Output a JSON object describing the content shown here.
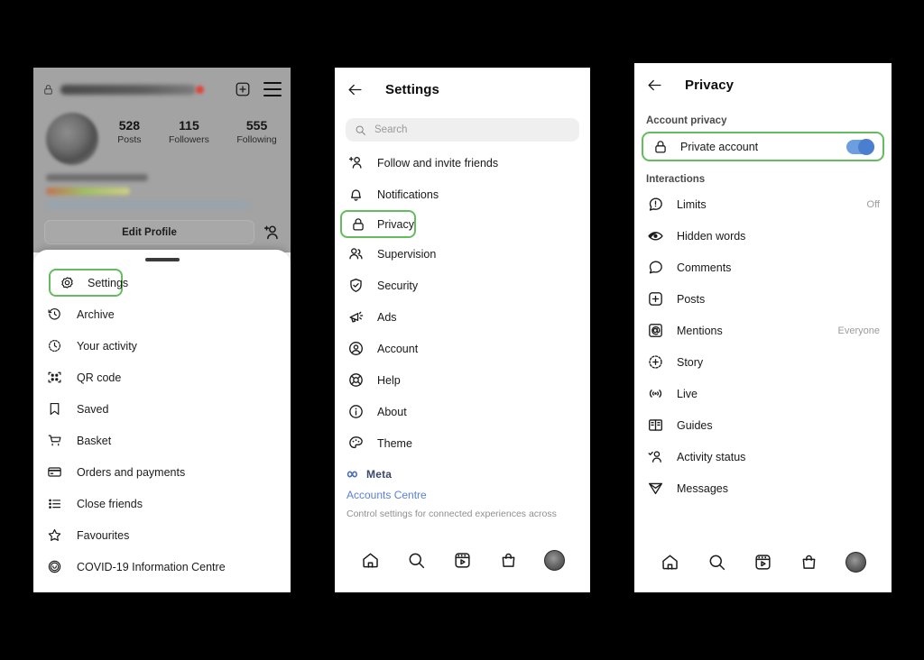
{
  "panel1": {
    "profile": {
      "lock_icon": "lock-icon",
      "username_redacted": "",
      "add_icon": "plus-square-icon",
      "menu_icon": "hamburger-menu-icon",
      "stats": [
        {
          "number": "528",
          "label": "Posts"
        },
        {
          "number": "115",
          "label": "Followers"
        },
        {
          "number": "555",
          "label": "Following"
        }
      ],
      "edit_profile_label": "Edit Profile",
      "add_person_icon": "add-person-icon"
    },
    "sheet_items": [
      {
        "label": "Settings",
        "icon": "gear-icon",
        "highlighted": true
      },
      {
        "label": "Archive",
        "icon": "archive-clock-icon",
        "highlighted": false
      },
      {
        "label": "Your activity",
        "icon": "activity-clock-icon",
        "highlighted": false
      },
      {
        "label": "QR code",
        "icon": "qr-code-icon",
        "highlighted": false
      },
      {
        "label": "Saved",
        "icon": "bookmark-icon",
        "highlighted": false
      },
      {
        "label": "Basket",
        "icon": "basket-icon",
        "highlighted": false
      },
      {
        "label": "Orders and payments",
        "icon": "card-icon",
        "highlighted": false
      },
      {
        "label": "Close friends",
        "icon": "list-icon",
        "highlighted": false
      },
      {
        "label": "Favourites",
        "icon": "star-icon",
        "highlighted": false
      },
      {
        "label": "COVID-19 Information Centre",
        "icon": "covid-icon",
        "highlighted": false
      }
    ]
  },
  "panel2": {
    "header": {
      "back_icon": "back-arrow-icon",
      "title": "Settings"
    },
    "search": {
      "placeholder": "Search",
      "icon": "search-icon"
    },
    "items": [
      {
        "label": "Follow and invite friends",
        "icon": "add-person-icon",
        "highlighted": false
      },
      {
        "label": "Notifications",
        "icon": "bell-icon",
        "highlighted": false
      },
      {
        "label": "Privacy",
        "icon": "lock-icon",
        "highlighted": true
      },
      {
        "label": "Supervision",
        "icon": "people-icon",
        "highlighted": false
      },
      {
        "label": "Security",
        "icon": "shield-check-icon",
        "highlighted": false
      },
      {
        "label": "Ads",
        "icon": "megaphone-icon",
        "highlighted": false
      },
      {
        "label": "Account",
        "icon": "account-circle-icon",
        "highlighted": false
      },
      {
        "label": "Help",
        "icon": "help-globe-icon",
        "highlighted": false
      },
      {
        "label": "About",
        "icon": "info-icon",
        "highlighted": false
      },
      {
        "label": "Theme",
        "icon": "palette-icon",
        "highlighted": false
      }
    ],
    "meta": {
      "brand_icon": "meta-infinity-icon",
      "brand_label": "Meta",
      "accounts_centre_link": "Accounts Centre",
      "description": "Control settings for connected experiences across"
    },
    "tabbar": [
      "home-icon",
      "search-icon",
      "reels-icon",
      "shop-icon",
      "profile-avatar"
    ]
  },
  "panel3": {
    "header": {
      "back_icon": "back-arrow-icon",
      "title": "Privacy"
    },
    "account_privacy": {
      "section_label": "Account privacy",
      "row": {
        "label": "Private account",
        "icon": "lock-icon",
        "toggle_on": true,
        "toggle_color": "#4a7fd0"
      }
    },
    "interactions": {
      "section_label": "Interactions",
      "items": [
        {
          "label": "Limits",
          "icon": "limits-icon",
          "value": "Off"
        },
        {
          "label": "Hidden words",
          "icon": "hidden-words-eye-icon",
          "value": ""
        },
        {
          "label": "Comments",
          "icon": "comment-bubble-icon",
          "value": ""
        },
        {
          "label": "Posts",
          "icon": "plus-square-icon",
          "value": ""
        },
        {
          "label": "Mentions",
          "icon": "at-mention-icon",
          "value": "Everyone"
        },
        {
          "label": "Story",
          "icon": "story-plus-icon",
          "value": ""
        },
        {
          "label": "Live",
          "icon": "live-broadcast-icon",
          "value": ""
        },
        {
          "label": "Guides",
          "icon": "guides-book-icon",
          "value": ""
        },
        {
          "label": "Activity status",
          "icon": "activity-status-icon",
          "value": ""
        },
        {
          "label": "Messages",
          "icon": "messages-send-icon",
          "value": ""
        }
      ]
    },
    "tabbar": [
      "home-icon",
      "search-icon",
      "reels-icon",
      "shop-icon",
      "profile-avatar"
    ]
  },
  "theme": {
    "highlight_green": "#63bd5e",
    "link_blue": "#5a7fd4",
    "toggle_blue": "#6d9fe0",
    "background": "#000000",
    "panel_bg": "#ffffff"
  }
}
